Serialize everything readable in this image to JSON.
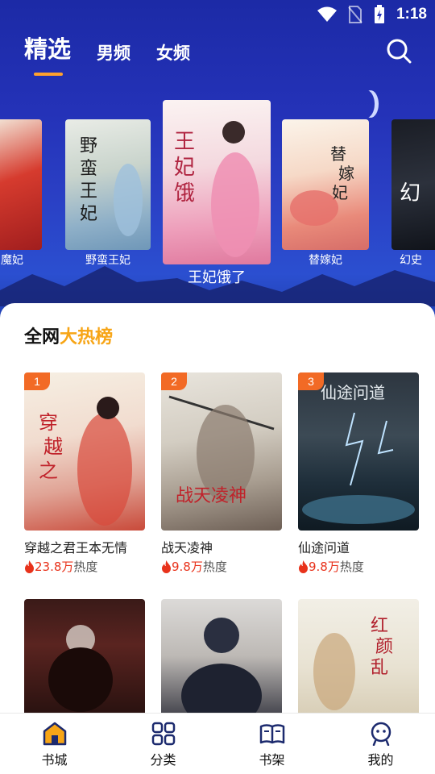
{
  "status": {
    "time": "1:18"
  },
  "header": {
    "tabs": [
      {
        "label": "精选",
        "active": true
      },
      {
        "label": "男频",
        "active": false
      },
      {
        "label": "女频",
        "active": false
      }
    ]
  },
  "carousel": {
    "items": [
      {
        "title": "魔妃"
      },
      {
        "title": "野蛮王妃"
      },
      {
        "title": "王妃饿了"
      },
      {
        "title": "替嫁妃"
      },
      {
        "title": "幻史"
      }
    ]
  },
  "ranking": {
    "title_prefix": "全网",
    "title_highlight": "大热榜",
    "books": [
      {
        "rank": "1",
        "name": "穿越之君王本无情",
        "heat_num": "23.8万",
        "heat_label": "热度"
      },
      {
        "rank": "2",
        "name": "战天凌神",
        "heat_num": "9.8万",
        "heat_label": "热度"
      },
      {
        "rank": "3",
        "name": "仙途问道",
        "heat_num": "9.8万",
        "heat_label": "热度"
      }
    ]
  },
  "bottom_nav": {
    "items": [
      {
        "label": "书城",
        "active": true
      },
      {
        "label": "分类",
        "active": false
      },
      {
        "label": "书架",
        "active": false
      },
      {
        "label": "我的",
        "active": false
      }
    ]
  },
  "colors": {
    "accent": "#f7a516",
    "heat": "#e8321b",
    "rank_badge": "#f26a25",
    "hero_bg": "#2432b8"
  }
}
